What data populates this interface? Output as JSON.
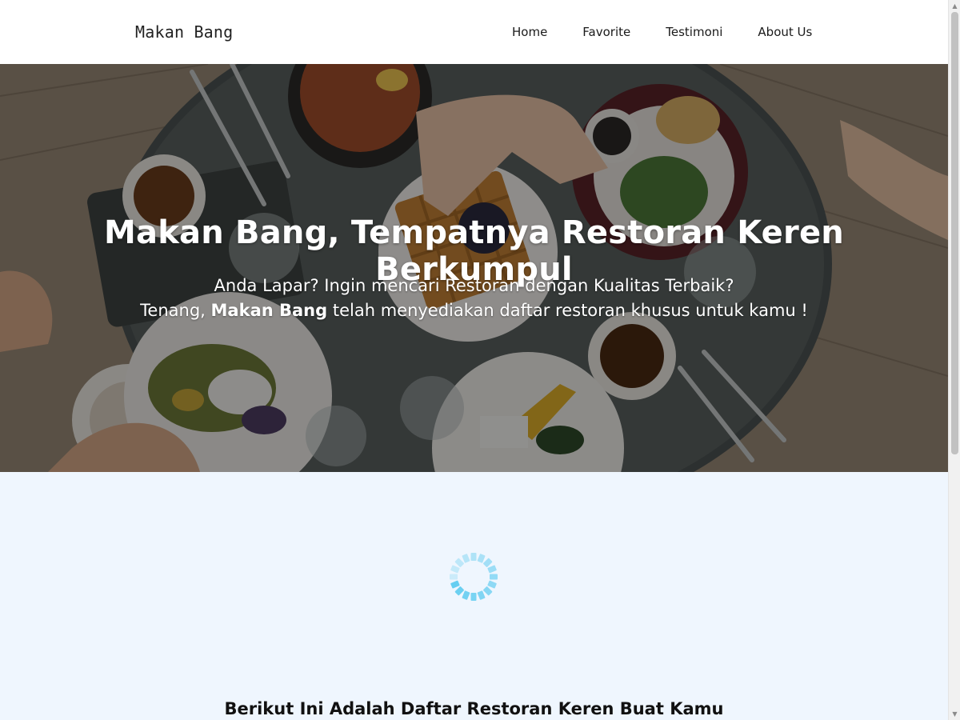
{
  "header": {
    "brand": "Makan Bang",
    "nav": [
      {
        "label": "Home"
      },
      {
        "label": "Favorite"
      },
      {
        "label": "Testimoni"
      },
      {
        "label": "About Us"
      }
    ]
  },
  "hero": {
    "title": "Makan Bang, Tempatnya Restoran Keren Berkumpul",
    "subtitle_line1": "Anda Lapar? Ingin mencari Restoran dengan Kualitas Terbaik?",
    "subtitle_line2_prefix": "Tenang, ",
    "subtitle_line2_bold": "Makan Bang",
    "subtitle_line2_suffix": " telah menyediakan daftar restoran khusus untuk kamu !"
  },
  "content": {
    "loading_indicator": "spinner-icon",
    "section_title": "Berikut Ini Adalah Daftar Restoran Keren Buat Kamu"
  },
  "colors": {
    "header_bg": "#ffffff",
    "content_bg": "#eff6fe",
    "spinner": "#5ecbf0",
    "hero_text": "#ffffff"
  },
  "icons": {
    "scroll_up": "chevron-up-icon",
    "scroll_down": "chevron-down-icon"
  }
}
